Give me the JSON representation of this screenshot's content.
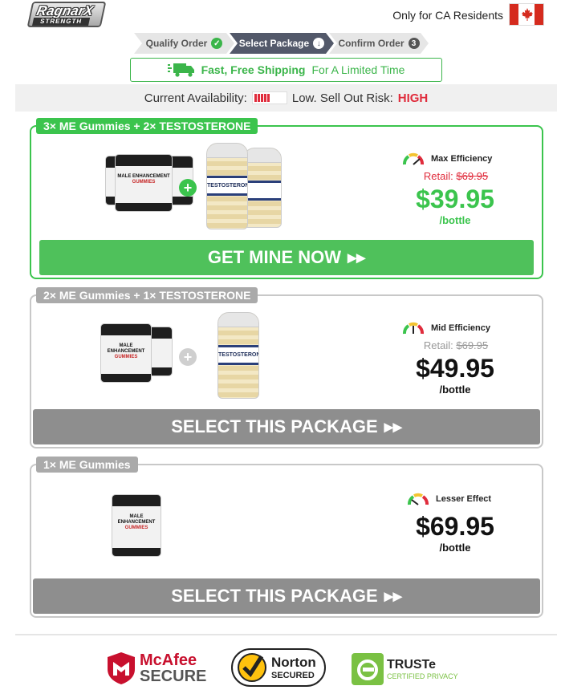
{
  "brand": {
    "logo_word": "RagnarX",
    "logo_sub": "STRENGTH"
  },
  "header": {
    "residents": "Only for CA Residents"
  },
  "steps": [
    {
      "label": "Qualify Order",
      "icon": "check-icon",
      "state": "done"
    },
    {
      "label": "Select Package",
      "icon": "arrow-down-icon",
      "state": "active"
    },
    {
      "label": "Confirm Order",
      "badge": "3",
      "state": "upcoming"
    }
  ],
  "shipping": {
    "bold": "Fast, Free Shipping",
    "rest": "For A Limited Time"
  },
  "availability": {
    "label": "Current Availability:",
    "level_fraction": 0.5,
    "risk_label": "Low. Sell Out Risk:",
    "risk_value": "HIGH"
  },
  "packages": [
    {
      "tag": "3× ME Gummies + 2× TESTOSTERONE",
      "efficiency": "Max Efficiency",
      "retail_label": "Retail:",
      "retail_price": "$69.95",
      "price": "$39.95",
      "per": "/bottle",
      "cta": "GET MINE NOW",
      "cta_icon": "double-chevron-right-icon"
    },
    {
      "tag": "2× ME Gummies + 1× TESTOSTERONE",
      "efficiency": "Mid Efficiency",
      "retail_label": "Retail:",
      "retail_price": "$69.95",
      "price": "$49.95",
      "per": "/bottle",
      "cta": "SELECT THIS PACKAGE",
      "cta_icon": "double-chevron-right-icon"
    },
    {
      "tag": "1× ME Gummies",
      "efficiency": "Lesser Effect",
      "price": "$69.95",
      "per": "/bottle",
      "cta": "SELECT THIS PACKAGE",
      "cta_icon": "double-chevron-right-icon"
    }
  ],
  "product_labels": {
    "gummies_top": "MALE ENHANCEMENT",
    "gummies_sub": "GUMMIES",
    "testo": "TESTOSTERONE"
  },
  "trust": {
    "mcafee": {
      "top": "McAfee",
      "bottom": "SECURE"
    },
    "norton": {
      "top": "Norton",
      "bottom": "SECURED"
    },
    "truste": {
      "top": "TRUSTe",
      "bottom": "CERTIFIED PRIVACY"
    }
  },
  "colors": {
    "accent_green": "#3bc44d",
    "alert_red": "#e02c3c",
    "step_active": "#53596a",
    "cta_grey": "#8e8e8e"
  }
}
